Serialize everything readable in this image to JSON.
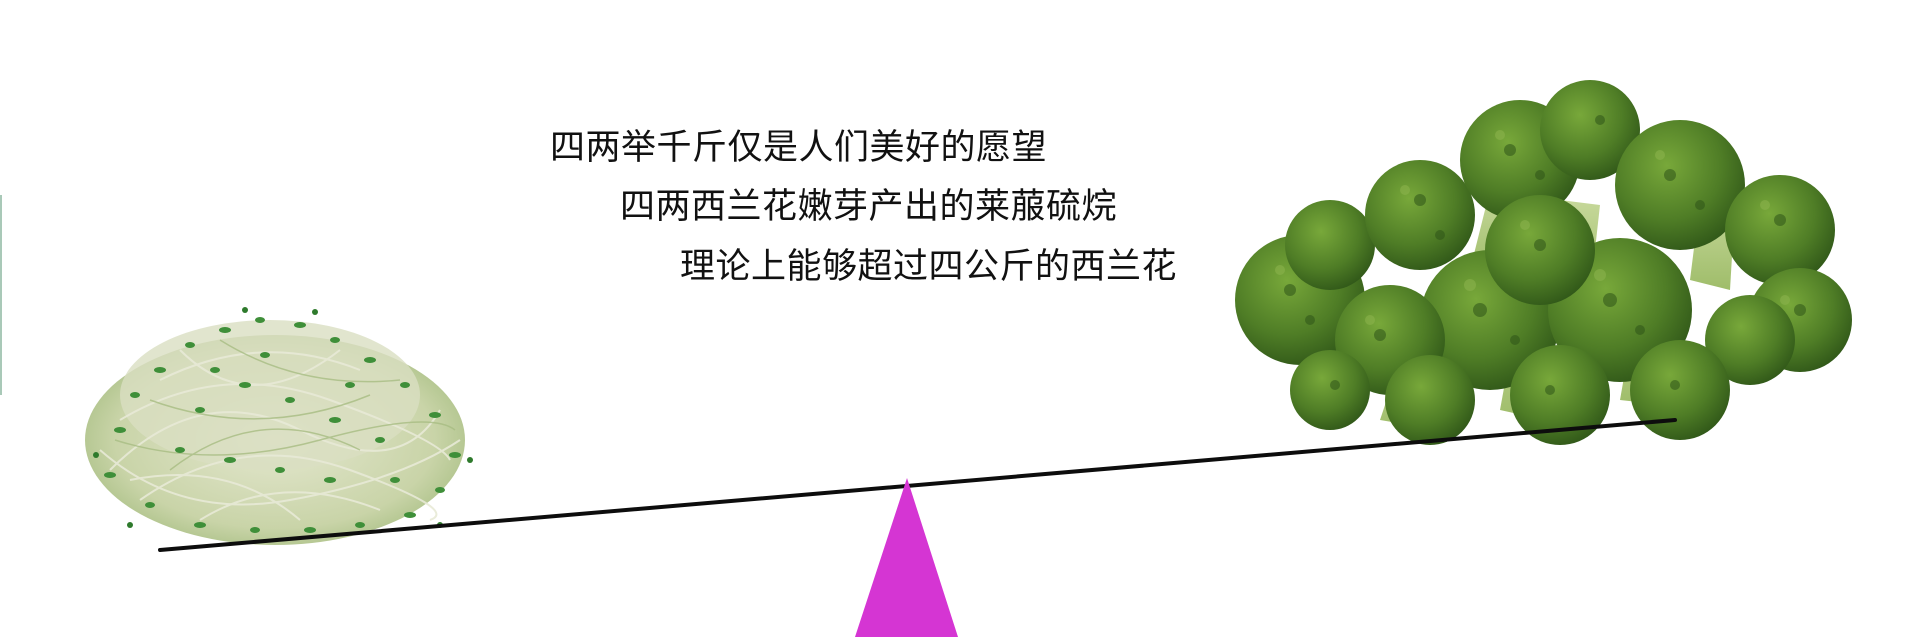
{
  "caption": {
    "lines": [
      "四两举千斤仅是人们美好的愿望",
      "四两西兰花嫩芽产出的莱菔硫烷",
      "理论上能够超过四公斤的西兰花"
    ]
  },
  "colors": {
    "fulcrum": "#d535d3",
    "beam": "#0d0d0d",
    "sprout_green": "#3e8c3a",
    "sprout_stem": "#d8dcc0",
    "broccoli_dark": "#3d6a1f",
    "broccoli_mid": "#5f8f2e",
    "broccoli_stem": "#b9cf8a"
  }
}
